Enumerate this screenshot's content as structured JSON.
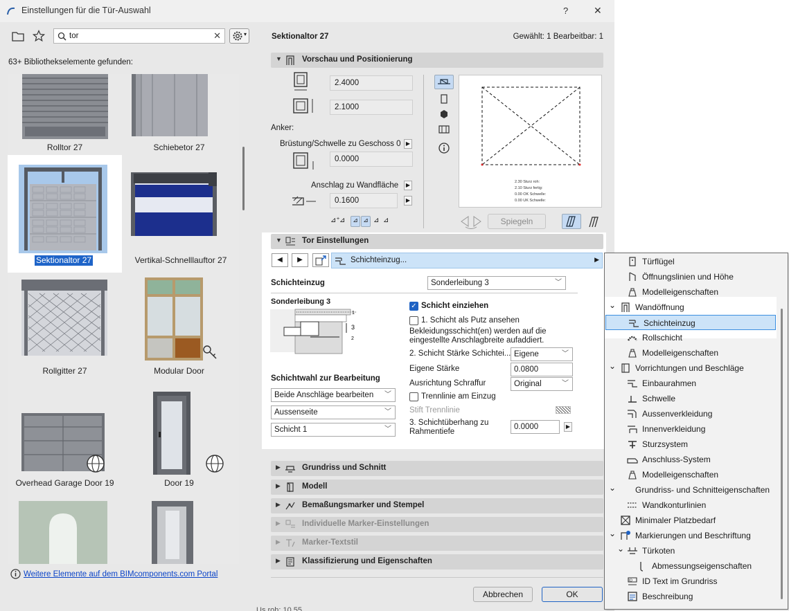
{
  "window": {
    "title": "Einstellungen für die Tür-Auswahl",
    "help_label": "?",
    "close_label": "✕"
  },
  "left": {
    "search_value": "tor",
    "found_text": "63+ Bibliothekselemente gefunden:",
    "items": [
      {
        "label": "Rolltor 27"
      },
      {
        "label": "Schiebetor 27"
      },
      {
        "label": "Sektionaltor 27"
      },
      {
        "label": "Vertikal-Schnelllauftor 27"
      },
      {
        "label": "Rollgitter 27"
      },
      {
        "label": "Modular Door"
      },
      {
        "label": "Overhead Garage Door 19"
      },
      {
        "label": "Door 19"
      }
    ],
    "portal_link": "Weitere Elemente auf dem BIMcomponents.com Portal"
  },
  "right": {
    "element_name": "Sektionaltor 27",
    "selected_info": "Gewählt: 1 Bearbeitbar: 1",
    "preview_panel": "Vorschau und Positionierung",
    "width": "2.4000",
    "height": "2.1000",
    "anchor_label": "Anker:",
    "sill_label": "Brüstung/Schwelle zu Geschoss 0",
    "sill_value": "0.0000",
    "reveal_label": "Anschlag zu Wandfläche",
    "reveal_value": "0.1600",
    "mirror_label": "Spiegeln",
    "preview_text": [
      "2.30 Sturz roh:",
      "2.10 Sturz fertig:",
      "0.00 OK Schwelle:",
      "0.00 UK Schwelle:"
    ],
    "tor_panel": "Tor Einstellungen",
    "nav_selected": "Schichteinzug...",
    "schichteinzug_label": "Schichteinzug",
    "schichteinzug_value": "Sonderleibung 3",
    "diagram_title": "Sonderleibung 3",
    "diagram_nums": [
      "1",
      "3",
      "2"
    ],
    "cb_schicht_einziehen": "Schicht einziehen",
    "cb_putz": "1. Schicht als Putz ansehen",
    "note": "Bekleidungsschicht(en) werden auf die eingestellte Anschlagbreite aufaddiert.",
    "staerke_label": "2. Schicht Stärke Schichtei...",
    "staerke_value": "Eigene",
    "eigene_label": "Eigene Stärke",
    "eigene_value": "0.0800",
    "ausrichtung_label": "Ausrichtung Schraffur",
    "ausrichtung_value": "Original",
    "trennlinie_label": "Trennlinie am Einzug",
    "stift_label": "Stift Trennlinie",
    "ueberhang_label": "3. Schichtüberhang zu Rahmentiefe",
    "ueberhang_value": "0.0000",
    "schichtwahl_label": "Schichtwahl zur Bearbeitung",
    "schichtwahl_options": [
      "Beide Anschläge bearbeiten",
      "Aussenseite",
      "Schicht 1"
    ],
    "collapsed_panels": [
      {
        "label": "Grundriss und Schnitt",
        "disabled": false
      },
      {
        "label": "Modell",
        "disabled": false
      },
      {
        "label": "Bemaßungsmarker und Stempel",
        "disabled": false
      },
      {
        "label": "Individuelle Marker-Einstellungen",
        "disabled": true
      },
      {
        "label": "Marker-Textstil",
        "disabled": true
      },
      {
        "label": "Klassifizierung und Eigenschaften",
        "disabled": false
      }
    ],
    "cancel_label": "Abbrechen",
    "ok_label": "OK"
  },
  "tree": [
    {
      "label": "Türflügel",
      "level": 1,
      "arrow": ""
    },
    {
      "label": "Öffnungslinien und Höhe",
      "level": 1,
      "arrow": ""
    },
    {
      "label": "Modelleigenschaften",
      "level": 1,
      "arrow": ""
    },
    {
      "label": "Wandöffnung",
      "level": 0,
      "arrow": "⌄"
    },
    {
      "label": "Schichteinzug",
      "level": 1,
      "arrow": "",
      "selected": true
    },
    {
      "label": "Rollschicht",
      "level": 1,
      "arrow": ""
    },
    {
      "label": "Modelleigenschaften",
      "level": 1,
      "arrow": ""
    },
    {
      "label": "Vorrichtungen und Beschläge",
      "level": 0,
      "arrow": "⌄"
    },
    {
      "label": "Einbaurahmen",
      "level": 1,
      "arrow": ""
    },
    {
      "label": "Schwelle",
      "level": 1,
      "arrow": ""
    },
    {
      "label": "Aussenverkleidung",
      "level": 1,
      "arrow": ""
    },
    {
      "label": "Innenverkleidung",
      "level": 1,
      "arrow": ""
    },
    {
      "label": "Sturzsystem",
      "level": 1,
      "arrow": ""
    },
    {
      "label": "Anschluss-System",
      "level": 1,
      "arrow": ""
    },
    {
      "label": "Modelleigenschaften",
      "level": 1,
      "arrow": ""
    },
    {
      "label": "Grundriss- und Schnitteigenschaften",
      "level": 0,
      "arrow": "⌄",
      "noicon": true
    },
    {
      "label": "Wandkonturlinien",
      "level": 1,
      "arrow": ""
    },
    {
      "label": "Minimaler Platzbedarf",
      "level": 0,
      "arrow": ""
    },
    {
      "label": "Markierungen und Beschriftung",
      "level": 0,
      "arrow": "⌄"
    },
    {
      "label": "Türkoten",
      "level": 1,
      "arrow": "⌄"
    },
    {
      "label": "Abmessungseigenschaften",
      "level": 2,
      "arrow": ""
    },
    {
      "label": "ID Text im Grundriss",
      "level": 1,
      "arrow": ""
    },
    {
      "label": "Beschreibung",
      "level": 1,
      "arrow": ""
    }
  ],
  "bottom_fragment": "Us roh:     10.55"
}
